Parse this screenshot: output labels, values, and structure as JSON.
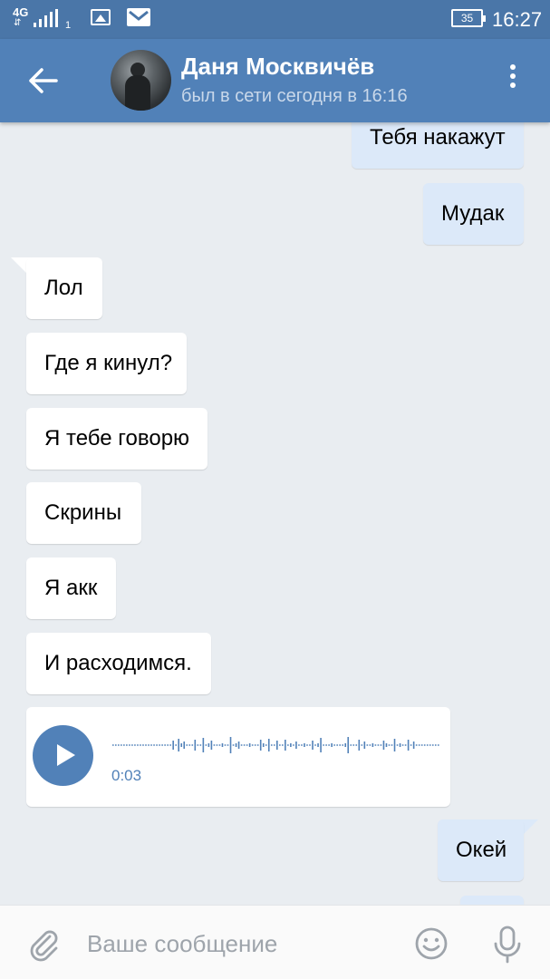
{
  "status_bar": {
    "network": "4G",
    "arrows": "⇵",
    "sim": "1",
    "battery": "35",
    "time": "16:27"
  },
  "header": {
    "contact_name": "Даня Москвичёв",
    "contact_status": "был в сети сегодня в 16:16"
  },
  "messages": [
    {
      "side": "out",
      "text": "Тебя накажут"
    },
    {
      "side": "out",
      "text": "Мудак"
    },
    {
      "side": "in",
      "text": "Лол"
    },
    {
      "side": "in",
      "text": "Где я кинул?"
    },
    {
      "side": "in",
      "text": "Я тебе говорю"
    },
    {
      "side": "in",
      "text": "Скрины"
    },
    {
      "side": "in",
      "text": "Я акк"
    },
    {
      "side": "in",
      "text": "И расходимся."
    },
    {
      "side": "in",
      "type": "voice",
      "duration": "0:03"
    },
    {
      "side": "out",
      "text": "Окей"
    }
  ],
  "composer": {
    "placeholder": "Ваше сообщение"
  },
  "colors": {
    "header": "#5181b8",
    "status_bar": "#4a76a8",
    "incoming_bubble": "#ffffff",
    "outgoing_bubble": "#dce9f9",
    "background": "#e9edf1",
    "accent": "#5181b8"
  },
  "icons": [
    "back-arrow-icon",
    "more-vertical-icon",
    "attach-icon",
    "emoji-icon",
    "microphone-icon",
    "play-icon",
    "signal-icon",
    "image-icon",
    "mail-icon",
    "battery-icon"
  ]
}
